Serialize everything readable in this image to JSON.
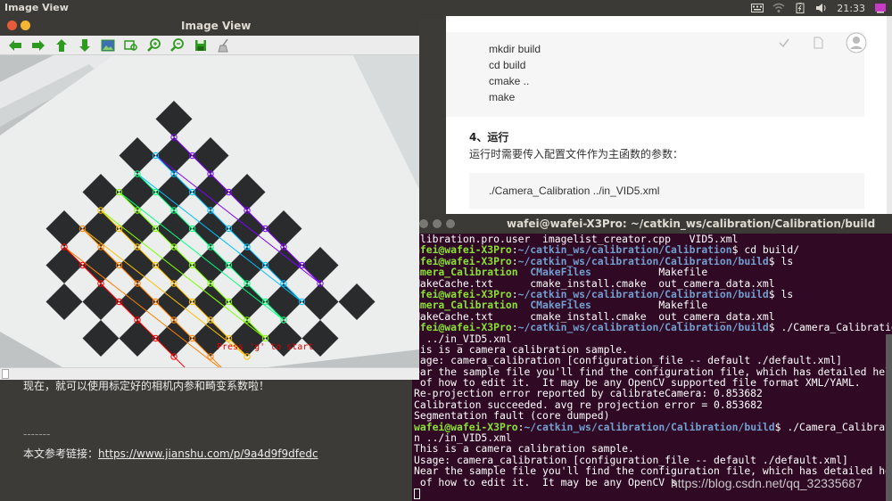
{
  "topbar": {
    "app_name": "Image View",
    "clock": "21:33"
  },
  "image_view": {
    "title": "Image View",
    "overlay_text": "Press 'g' to start",
    "toolbar": [
      {
        "name": "back-icon",
        "color": "#2e9a1f"
      },
      {
        "name": "forward-icon",
        "color": "#2e9a1f"
      },
      {
        "name": "up-icon",
        "color": "#2e9a1f"
      },
      {
        "name": "down-icon",
        "color": "#2e9a1f"
      },
      {
        "name": "image-icon",
        "color": "#3d6fb5"
      },
      {
        "name": "fit-icon",
        "color": "#2e9a1f"
      },
      {
        "name": "zoom-in-icon",
        "color": "#2e9a1f"
      },
      {
        "name": "zoom-out-icon",
        "color": "#2e9a1f"
      },
      {
        "name": "save-icon",
        "color": "#2e9a1f"
      },
      {
        "name": "clear-icon",
        "color": "#888888"
      }
    ]
  },
  "background_article": {
    "line1": "现在，就可以使用标定好的相机内参和畸变系数啦！",
    "divider": "-------",
    "ref_label": "本文参考链接：",
    "ref_url": "https://www.jianshu.com/p/9a4d9f9dfedc"
  },
  "browser": {
    "code_lines": [
      "mkdir build",
      "cd build",
      "cmake ..",
      "make"
    ],
    "heading": "4、运行",
    "paragraph": "运行时需要传入配置文件作为主函数的参数：",
    "run_cmd": "./Camera_Calibration ../in_VID5.xml"
  },
  "terminal": {
    "title": "wafei@wafei-X3Pro: ~/catkin_ws/calibration/Calibration/build",
    "lines": [
      [
        {
          "c": "w",
          "t": "alibration.pro.user  imagelist_creator.cpp   VID5.xml"
        }
      ],
      [
        {
          "c": "g",
          "t": "afei@wafei-X3Pro"
        },
        {
          "c": "w",
          "t": ":"
        },
        {
          "c": "b",
          "t": "~/catkin_ws/calibration/Calibration"
        },
        {
          "c": "w",
          "t": "$ cd build/"
        }
      ],
      [
        {
          "c": "g",
          "t": "afei@wafei-X3Pro"
        },
        {
          "c": "w",
          "t": ":"
        },
        {
          "c": "b",
          "t": "~/catkin_ws/calibration/Calibration/build"
        },
        {
          "c": "w",
          "t": "$ ls"
        }
      ],
      [
        {
          "c": "g",
          "t": "amera_Calibration  "
        },
        {
          "c": "b",
          "t": "CMakeFiles"
        },
        {
          "c": "w",
          "t": "           Makefile"
        }
      ],
      [
        {
          "c": "w",
          "t": "MakeCache.txt      cmake_install.cmake  out_camera_data.xml"
        }
      ],
      [
        {
          "c": "g",
          "t": "afei@wafei-X3Pro"
        },
        {
          "c": "w",
          "t": ":"
        },
        {
          "c": "b",
          "t": "~/catkin_ws/calibration/Calibration/build"
        },
        {
          "c": "w",
          "t": "$ ls"
        }
      ],
      [
        {
          "c": "g",
          "t": "amera_Calibration  "
        },
        {
          "c": "b",
          "t": "CMakeFiles"
        },
        {
          "c": "w",
          "t": "           Makefile"
        }
      ],
      [
        {
          "c": "w",
          "t": "MakeCache.txt      cmake_install.cmake  out_camera_data.xml"
        }
      ],
      [
        {
          "c": "g",
          "t": "afei@wafei-X3Pro"
        },
        {
          "c": "w",
          "t": ":"
        },
        {
          "c": "b",
          "t": "~/catkin_ws/calibration/Calibration/build"
        },
        {
          "c": "w",
          "t": "$ ./Camera_Calibratio"
        }
      ],
      [
        {
          "c": "w",
          "t": "  ../in_VID5.xml"
        }
      ],
      [
        {
          "c": "w",
          "t": "his is a camera calibration sample."
        }
      ],
      [
        {
          "c": "w",
          "t": "sage: camera_calibration [configuration_file -- default ./default.xml]"
        }
      ],
      [
        {
          "c": "w",
          "t": "ear the sample file you'll find the configuration file, which has detailed help"
        }
      ],
      [
        {
          "c": "w",
          "t": " of how to edit it.  It may be any OpenCV supported file format XML/YAML."
        }
      ],
      [
        {
          "c": "w",
          "t": "Re-projection error reported by calibrateCamera: 0.853682"
        }
      ],
      [
        {
          "c": "w",
          "t": "Calibration succeeded. avg re projection error = 0.853682"
        }
      ],
      [
        {
          "c": "w",
          "t": "Segmentation fault (core dumped)"
        }
      ],
      [
        {
          "c": "g",
          "t": "wafei@wafei-X3Pro"
        },
        {
          "c": "w",
          "t": ":"
        },
        {
          "c": "b",
          "t": "~/catkin_ws/calibration/Calibration/build"
        },
        {
          "c": "w",
          "t": "$ ./Camera_Calibratio"
        }
      ],
      [
        {
          "c": "w",
          "t": "n ../in_VID5.xml"
        }
      ],
      [
        {
          "c": "w",
          "t": "This is a camera calibration sample."
        }
      ],
      [
        {
          "c": "w",
          "t": "Usage: camera_calibration [configuration_file -- default ./default.xml]"
        }
      ],
      [
        {
          "c": "w",
          "t": "Near the sample file you'll find the configuration file, which has detailed help"
        }
      ],
      [
        {
          "c": "w",
          "t": " of how to edit it.  It may be any OpenCV s"
        }
      ]
    ],
    "watermark": "https://blog.csdn.net/qq_32335687"
  }
}
